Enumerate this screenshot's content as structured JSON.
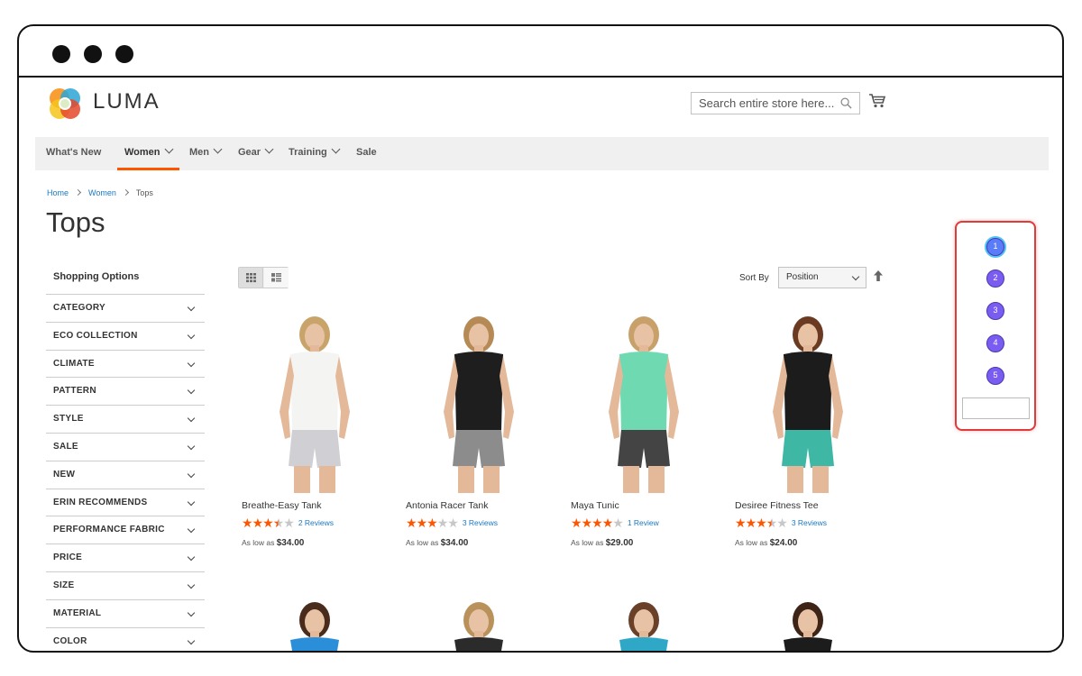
{
  "window": {
    "controls": [
      "close",
      "minimize",
      "maximize"
    ]
  },
  "header": {
    "brand": "LUMA",
    "search_placeholder": "Search entire store here...",
    "cart_icon": "cart-icon",
    "search_icon": "search-icon"
  },
  "nav": {
    "items": [
      {
        "label": "What's New",
        "has_menu": false
      },
      {
        "label": "Women",
        "has_menu": true,
        "active": true
      },
      {
        "label": "Men",
        "has_menu": true
      },
      {
        "label": "Gear",
        "has_menu": true
      },
      {
        "label": "Training",
        "has_menu": true
      },
      {
        "label": "Sale",
        "has_menu": false
      }
    ]
  },
  "breadcrumb": [
    "Home",
    "Women",
    "Tops"
  ],
  "page_title": "Tops",
  "sidebar": {
    "title": "Shopping Options",
    "filters": [
      "CATEGORY",
      "ECO COLLECTION",
      "CLIMATE",
      "PATTERN",
      "STYLE",
      "SALE",
      "NEW",
      "ERIN RECOMMENDS",
      "PERFORMANCE FABRIC",
      "PRICE",
      "SIZE",
      "MATERIAL",
      "COLOR"
    ]
  },
  "toolbar": {
    "view_modes": [
      "grid",
      "list"
    ],
    "active_view": "grid",
    "sort_label": "Sort By",
    "sort_value": "Position"
  },
  "products": [
    {
      "name": "Breathe-Easy Tank",
      "rating": 3.5,
      "reviews": "2  Reviews",
      "price_prefix": "As low as",
      "price": "$34.00",
      "top_color": "#f4f4f2",
      "bottom_color": "#cfcfd4",
      "hair_color": "#c9a46a"
    },
    {
      "name": "Antonia Racer Tank",
      "rating": 3,
      "reviews": "3  Reviews",
      "price_prefix": "As low as",
      "price": "$34.00",
      "top_color": "#1e1e1e",
      "bottom_color": "#8c8c8c",
      "hair_color": "#b58a55"
    },
    {
      "name": "Maya Tunic",
      "rating": 4,
      "reviews": "1  Review",
      "price_prefix": "As low as",
      "price": "$29.00",
      "top_color": "#6fd9b2",
      "bottom_color": "#444444",
      "hair_color": "#c7a06a"
    },
    {
      "name": "Desiree Fitness Tee",
      "rating": 3.5,
      "reviews": "3  Reviews",
      "price_prefix": "As low as",
      "price": "$24.00",
      "top_color": "#1c1c1c",
      "bottom_color": "#3fb7a5",
      "hair_color": "#6b3a22"
    }
  ],
  "products_row2": [
    {
      "top_color": "#2a8fd8",
      "hair_color": "#4a2c1c"
    },
    {
      "top_color": "#2b2b2b",
      "hair_color": "#b8925a"
    },
    {
      "top_color": "#2fa8c8",
      "hair_color": "#6a4028"
    },
    {
      "top_color": "#1c1c1c",
      "hair_color": "#3d2416"
    }
  ],
  "annotation": {
    "markers": [
      "1",
      "2",
      "3",
      "4",
      "5"
    ],
    "input_value": ""
  },
  "colors": {
    "accent": "#ff5501",
    "link": "#1979c3",
    "marker": "#7a5cf0",
    "annotation_border": "#e03a3a"
  }
}
